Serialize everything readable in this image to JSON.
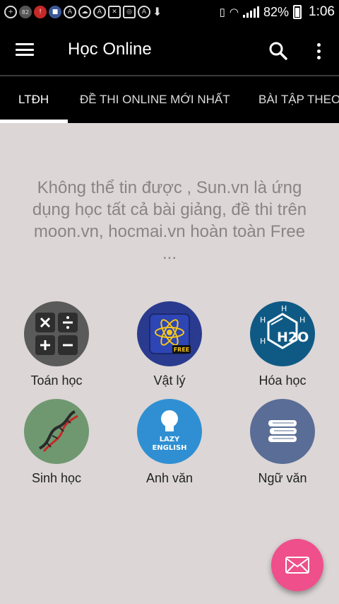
{
  "status_bar": {
    "notif_count": "82",
    "battery_percent": "82%",
    "time": "1:06"
  },
  "app_bar": {
    "title": "Học Online"
  },
  "tabs": [
    {
      "label": "LTĐH",
      "active": true
    },
    {
      "label": "ĐỀ THI ONLINE MỚI NHẤT",
      "active": false
    },
    {
      "label": "BÀI TẬP THEO",
      "active": false
    }
  ],
  "headline": "Không thể tin được , Sun.vn là ứng dụng học tất cả bài giảng, đề thi trên moon.vn, hocmai.vn hoàn toàn Free ...",
  "subjects": [
    {
      "label": "Toán học",
      "icon": "calculator-icon",
      "color": "#5a5a5a"
    },
    {
      "label": "Vật lý",
      "icon": "atom-icon",
      "color": "#2a3b8f",
      "badge": "FREE"
    },
    {
      "label": "Hóa học",
      "icon": "h2o-molecule-icon",
      "color": "#0f5a85",
      "formula_main": "H2O",
      "atom": "H"
    },
    {
      "label": "Sinh học",
      "icon": "dna-icon",
      "color": "#6f9870"
    },
    {
      "label": "Anh văn",
      "icon": "lightbulb-icon",
      "color": "#2f8fd2",
      "line1": "LAZY",
      "line2": "ENGLISH"
    },
    {
      "label": "Ngữ văn",
      "icon": "books-icon",
      "color": "#5a6d96"
    }
  ],
  "fab": {
    "icon": "mail-icon",
    "color": "#ef4f8b"
  }
}
